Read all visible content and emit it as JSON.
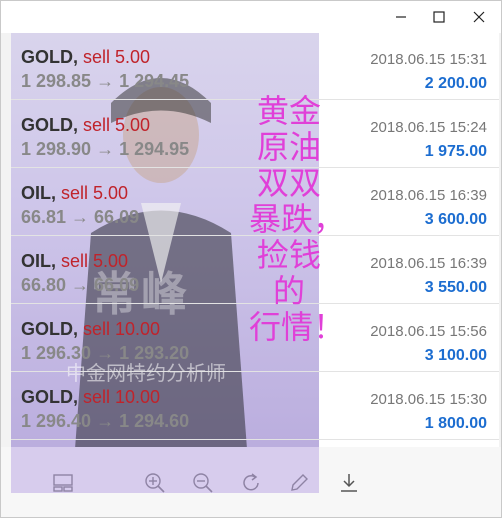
{
  "window": {
    "controls": {
      "minimize_icon": "minimize-icon",
      "maximize_icon": "maximize-icon",
      "close_icon": "close-icon"
    }
  },
  "rows": [
    {
      "symbol": "GOLD,",
      "type": "sell 5.00",
      "price": "1 298.85 → 1 294.45",
      "time": "2018.06.15 15:31",
      "profit": "2 200.00"
    },
    {
      "symbol": "GOLD,",
      "type": "sell 5.00",
      "price": "1 298.90 → 1 294.95",
      "time": "2018.06.15 15:24",
      "profit": "1 975.00"
    },
    {
      "symbol": "OIL,",
      "type": "sell 5.00",
      "price": "66.81 → 66.09",
      "time": "2018.06.15 16:39",
      "profit": "3 600.00"
    },
    {
      "symbol": "OIL,",
      "type": "sell 5.00",
      "price": "66.80 → 66.09",
      "time": "2018.06.15 16:39",
      "profit": "3 550.00"
    },
    {
      "symbol": "GOLD,",
      "type": "sell 10.00",
      "price": "1 296.30 → 1 293.20",
      "time": "2018.06.15 15:56",
      "profit": "3 100.00"
    },
    {
      "symbol": "GOLD,",
      "type": "sell 10.00",
      "price": "1 296.40 → 1 294.60",
      "time": "2018.06.15 15:30",
      "profit": "1 800.00"
    }
  ],
  "overlay": {
    "lines": [
      "黄金",
      "原油",
      "双双",
      "暴跌，",
      "捡钱",
      "的",
      "行情！"
    ]
  },
  "photo": {
    "bg_text": "常峰",
    "bg_sub": "中金网特约分析师"
  },
  "toolbar": {
    "icons": [
      "layout-icon",
      "zoom-in-icon",
      "zoom-out-icon",
      "rotate-icon",
      "edit-icon",
      "download-icon"
    ]
  },
  "colors": {
    "sell": "#c0232b",
    "profit": "#1c6dd0",
    "overlay_text": "#e040d8"
  }
}
